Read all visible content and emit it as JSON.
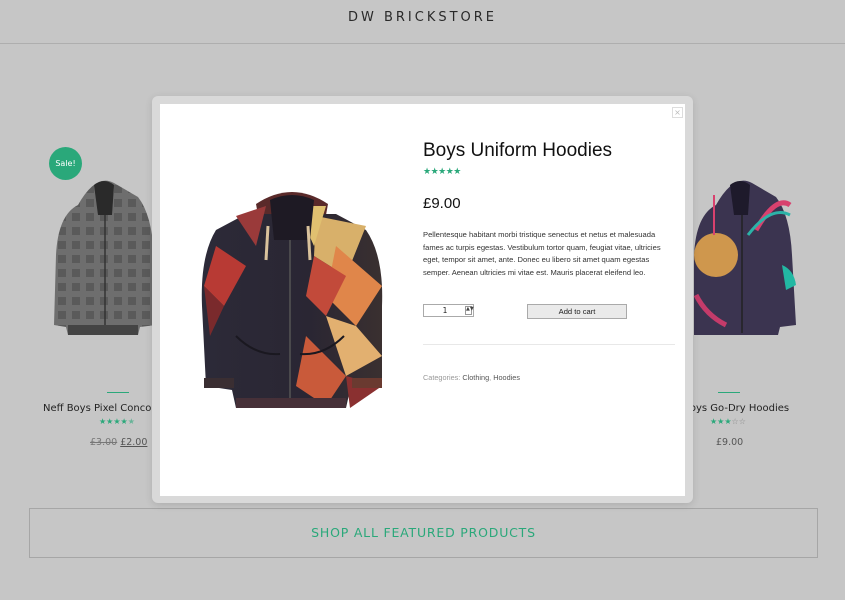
{
  "header": {
    "brand": "DW BRICKSTORE"
  },
  "background_products": {
    "left": {
      "badge": "Sale!",
      "name": "Neff Boys Pixel Concord F",
      "rating_stars": "★★★★",
      "rating_half": "★",
      "old_price": "£3.00",
      "new_price": "£2.00"
    },
    "right": {
      "name": "Boys Go-Dry Hoodies",
      "rating_full": "★★★",
      "rating_empty": "☆☆",
      "price": "£9.00"
    }
  },
  "shop_all": {
    "label": "SHOP ALL FEATURED PRODUCTS"
  },
  "modal": {
    "close": "×",
    "title": "Boys Uniform Hoodies",
    "rating": "★★★★★",
    "price": "£9.00",
    "description": "Pellentesque habitant morbi tristique senectus et netus et malesuada fames ac turpis egestas. Vestibulum tortor quam, feugiat vitae, ultricies eget, tempor sit amet, ante. Donec eu libero sit amet quam egestas semper. Aenean ultricies mi vitae est. Mauris placerat eleifend leo.",
    "quantity": "1",
    "quantity_spin": "▲▼",
    "add_to_cart": "Add to cart",
    "categories_label": "Categories:",
    "categories": [
      "Clothing",
      "Hoodies"
    ],
    "categories_sep": ", "
  },
  "colors": {
    "accent": "#2aa87a",
    "overlay_bg": "#c6c6c6",
    "modal_bg": "#ffffff"
  },
  "icons": {
    "close": "close-icon",
    "spinner": "spinner-icon",
    "star": "star-icon"
  }
}
